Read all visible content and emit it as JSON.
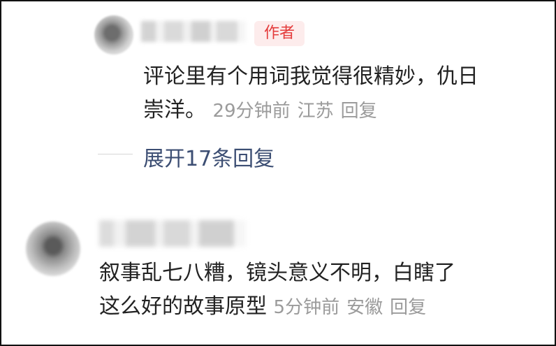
{
  "reply": {
    "author_tag": "作者",
    "text_line1": "评论里有个用词我觉得很精妙，仇日",
    "text_line2": "崇洋。",
    "time": "29分钟前",
    "location": "江苏",
    "reply_label": "回复"
  },
  "expand": {
    "label": "展开17条回复"
  },
  "comment": {
    "text_line1": "叙事乱七八糟，镜头意义不明，白瞎了",
    "text_line2": "这么好的故事原型",
    "time": "5分钟前",
    "location": "安徽",
    "reply_label": "回复"
  },
  "colors": {
    "author_tag_bg": "#fdecec",
    "author_tag_text": "#e43b3b",
    "link": "#3c4e73",
    "meta": "#9b9b9b"
  }
}
